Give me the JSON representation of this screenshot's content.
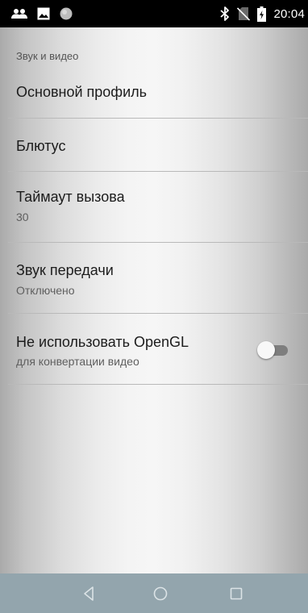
{
  "status_bar": {
    "time": "20:04",
    "left_icons": [
      "people-icon",
      "image-icon",
      "circle-icon"
    ],
    "right_icons": [
      "bluetooth-icon",
      "no-sim-icon",
      "battery-icon"
    ]
  },
  "section": {
    "header": "Звук и видео"
  },
  "preferences": {
    "main_profile": {
      "title": "Основной профиль"
    },
    "bluetooth": {
      "title": "Блютус"
    },
    "call_timeout": {
      "title": "Таймаут вызова",
      "summary": "30"
    },
    "transmit_sound": {
      "title": "Звук передачи",
      "summary": "Отключено"
    },
    "opengl": {
      "title": "Не использовать OpenGL",
      "summary": "для конвертации видео",
      "enabled": false
    }
  },
  "nav_bar": {
    "buttons": [
      "back-icon",
      "home-icon",
      "recents-icon"
    ]
  },
  "colors": {
    "status_bar": "#000000",
    "nav_bar": "#93a5ad",
    "title_text": "#1c1c1c",
    "summary_text": "#5f5f5f",
    "divider": "#b9b9b9"
  }
}
